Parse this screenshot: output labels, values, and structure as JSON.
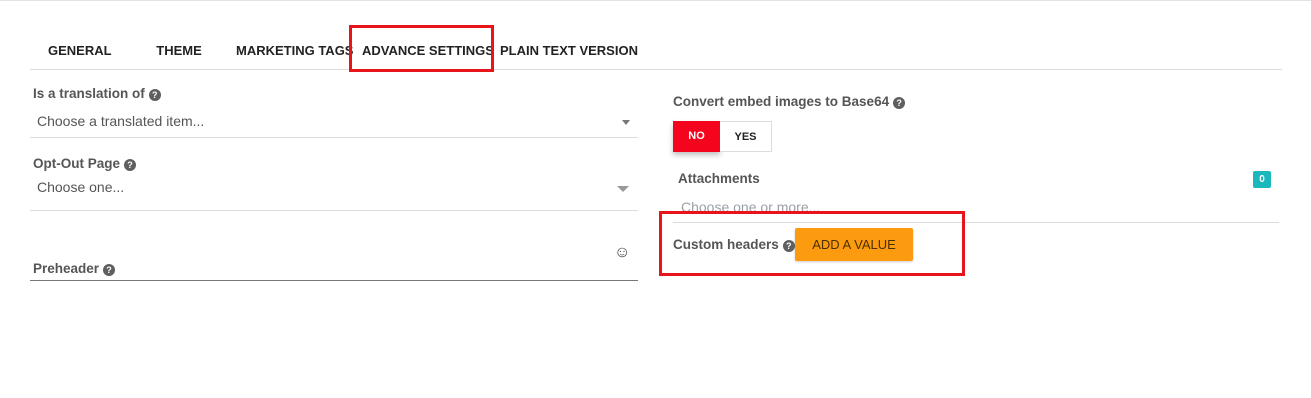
{
  "tabs": [
    {
      "label": "GENERAL"
    },
    {
      "label": "THEME"
    },
    {
      "label": "MARKETING TAGS"
    },
    {
      "label": "ADVANCE SETTINGS"
    },
    {
      "label": "PLAIN TEXT VERSION"
    }
  ],
  "left": {
    "translation": {
      "label": "Is a translation of",
      "value": "Choose a translated item..."
    },
    "optout": {
      "label": "Opt-Out Page",
      "value": "Choose one..."
    },
    "preheader": {
      "label": "Preheader",
      "emoji_icon": "☺"
    }
  },
  "right": {
    "base64": {
      "label": "Convert embed images to Base64",
      "no_label": "NO",
      "yes_label": "YES",
      "selected": "NO"
    },
    "attachments": {
      "label": "Attachments",
      "count": "0",
      "placeholder": "Choose one or more..."
    },
    "custom_headers": {
      "label": "Custom headers",
      "button_label": "ADD A VALUE"
    }
  },
  "help_icon_glyph": "?",
  "colors": {
    "highlight": "#e8141c",
    "toggle_no": "#f5051d",
    "badge": "#1ab8bd",
    "add_button": "#fd9b10"
  }
}
